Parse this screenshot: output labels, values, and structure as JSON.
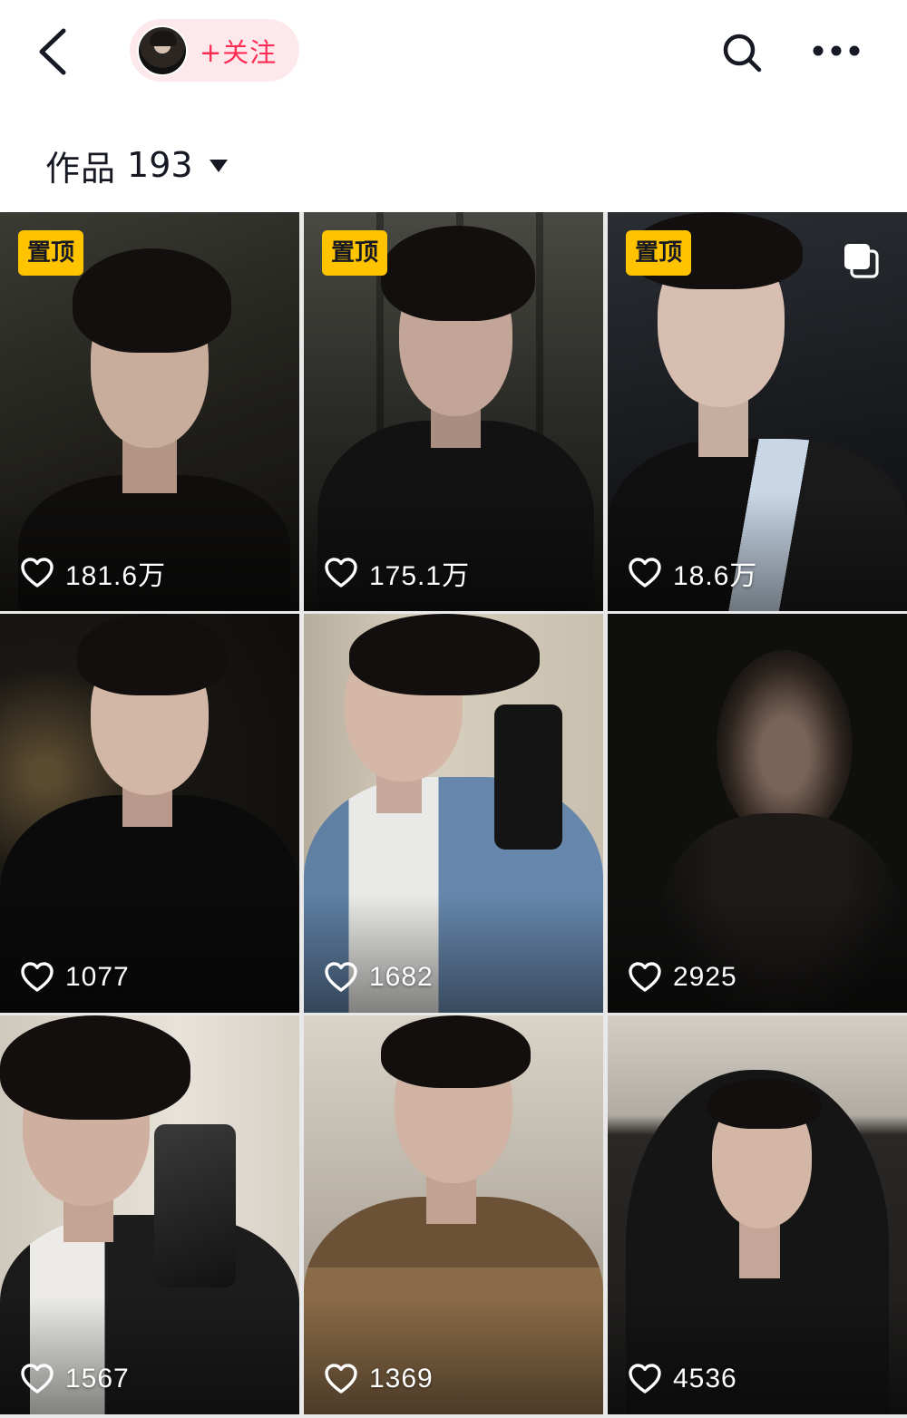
{
  "header": {
    "follow_label": "+关注"
  },
  "works": {
    "label": "作品",
    "count": "193"
  },
  "icons": {
    "back": "chevron-left-icon",
    "search": "search-icon",
    "more": "more-dots-icon",
    "like": "heart-icon",
    "multi": "multi-image-icon",
    "dropdown": "caret-down-icon"
  },
  "colors": {
    "follow_text": "#fe2c55",
    "follow_bg": "#fde9ec",
    "pin_badge": "#ffc300"
  },
  "tiles": [
    {
      "pinned": true,
      "pin_label": "置顶",
      "likes": "181.6万",
      "multi_image": false
    },
    {
      "pinned": true,
      "pin_label": "置顶",
      "likes": "175.1万",
      "multi_image": false
    },
    {
      "pinned": true,
      "pin_label": "置顶",
      "likes": "18.6万",
      "multi_image": true
    },
    {
      "pinned": false,
      "likes": "1077",
      "multi_image": false
    },
    {
      "pinned": false,
      "likes": "1682",
      "multi_image": false
    },
    {
      "pinned": false,
      "likes": "2925",
      "multi_image": false
    },
    {
      "pinned": false,
      "likes": "1567",
      "multi_image": false
    },
    {
      "pinned": false,
      "likes": "1369",
      "multi_image": false
    },
    {
      "pinned": false,
      "likes": "4536",
      "multi_image": false
    }
  ]
}
